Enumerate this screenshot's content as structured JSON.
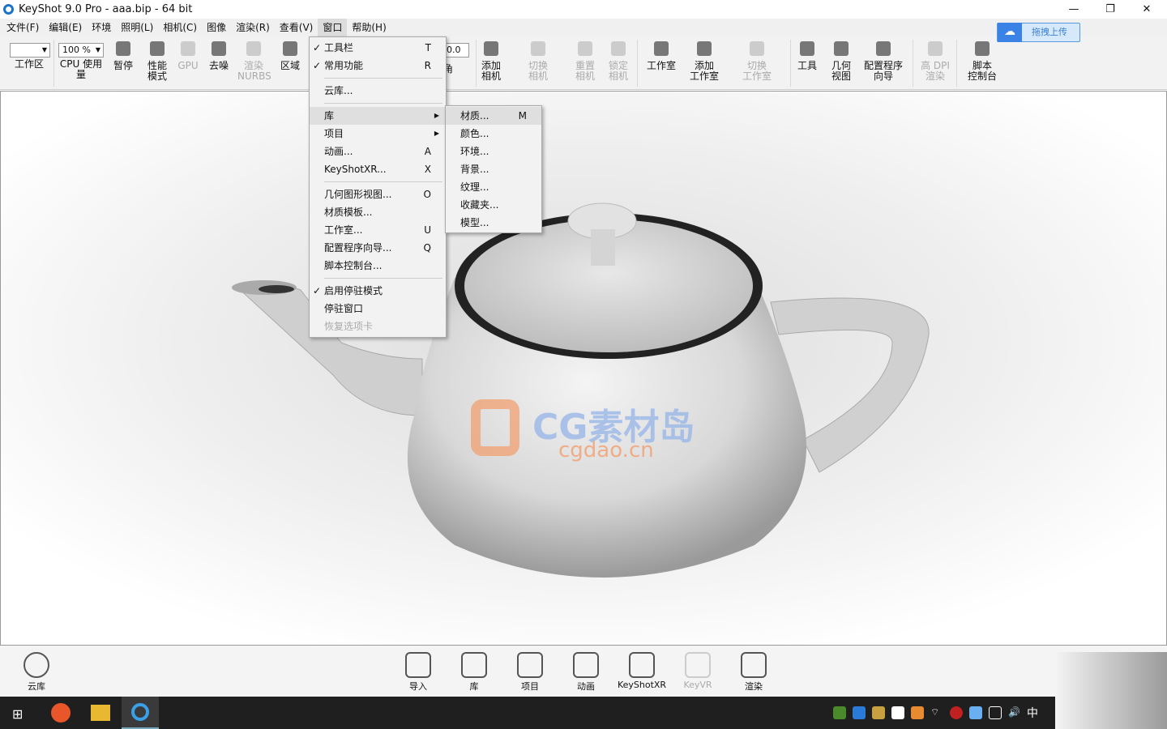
{
  "window": {
    "title": "KeyShot 9.0 Pro  - aaa.bip  - 64 bit",
    "minimize": "—",
    "restore": "❐",
    "close": "✕"
  },
  "menubar": [
    "文件(F)",
    "编辑(E)",
    "环境",
    "照明(L)",
    "相机(C)",
    "图像",
    "渲染(R)",
    "查看(V)",
    "窗口",
    "帮助(H)"
  ],
  "toolbar": {
    "workspace_select": "",
    "cpu_select": "100 %",
    "value_field": "0.0",
    "items": [
      {
        "label": "工作区"
      },
      {
        "label": "CPU 使用量"
      },
      {
        "label": "暂停"
      },
      {
        "label": "性能\n模式"
      },
      {
        "label": "GPU",
        "disabled": true
      },
      {
        "label": "去噪"
      },
      {
        "label": "渲染\nNURBS",
        "disabled": true
      },
      {
        "label": "区域"
      },
      {
        "label": "角"
      },
      {
        "label": "添加\n相机"
      },
      {
        "label": "切换\n相机",
        "disabled": true
      },
      {
        "label": "重置\n相机",
        "disabled": true
      },
      {
        "label": "锁定\n相机",
        "disabled": true
      },
      {
        "label": "工作室"
      },
      {
        "label": "添加\n工作室"
      },
      {
        "label": "切换\n工作室",
        "disabled": true
      },
      {
        "label": "工具"
      },
      {
        "label": "几何\n视图"
      },
      {
        "label": "配置程序\n向导"
      },
      {
        "label": "高 DPI\n渲染",
        "disabled": true
      },
      {
        "label": "脚本\n控制台"
      }
    ],
    "upload_button": "拖拽上传"
  },
  "window_menu": [
    {
      "label": "工具栏",
      "shortcut": "T",
      "checked": true
    },
    {
      "label": "常用功能",
      "shortcut": "R",
      "checked": true
    },
    {
      "sep": true
    },
    {
      "label": "云库..."
    },
    {
      "sep": true
    },
    {
      "label": "库",
      "submenu": true,
      "highlight": true
    },
    {
      "label": "项目",
      "submenu": true
    },
    {
      "label": "动画...",
      "shortcut": "A"
    },
    {
      "label": "KeyShotXR...",
      "shortcut": "X"
    },
    {
      "sep": true
    },
    {
      "label": "几何图形视图...",
      "shortcut": "O"
    },
    {
      "label": "材质模板..."
    },
    {
      "label": "工作室...",
      "shortcut": "U"
    },
    {
      "label": "配置程序向导...",
      "shortcut": "Q"
    },
    {
      "label": "脚本控制台..."
    },
    {
      "sep": true
    },
    {
      "label": "启用停驻模式",
      "checked": true
    },
    {
      "label": "停驻窗口"
    },
    {
      "label": "恢复选项卡",
      "disabled": true
    }
  ],
  "library_submenu": [
    {
      "label": "材质...",
      "shortcut": "M"
    },
    {
      "label": "颜色..."
    },
    {
      "label": "环境..."
    },
    {
      "label": "背景..."
    },
    {
      "label": "纹理..."
    },
    {
      "label": "收藏夹..."
    },
    {
      "label": "模型..."
    }
  ],
  "watermark": {
    "line1": "CG素材岛",
    "line2": "cgdao.cn"
  },
  "bottombar": {
    "cloud": "云库",
    "items": [
      "导入",
      "库",
      "项目",
      "动画",
      "KeyShotXR",
      "KeyVR",
      "渲染"
    ]
  },
  "taskbar": {
    "ime": "中"
  }
}
